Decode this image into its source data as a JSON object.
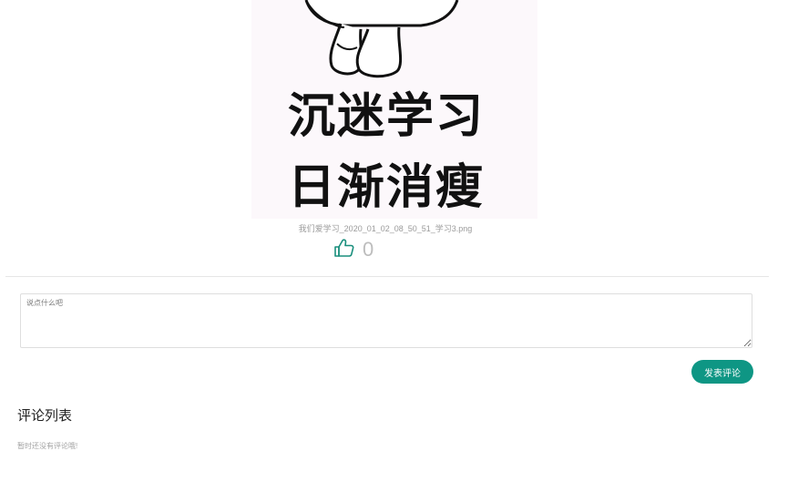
{
  "post": {
    "image_text_line1": "沉迷学习",
    "image_text_line2": "日渐消瘦",
    "image_caption": "我们爱学习_2020_01_02_08_50_51_学习3.png",
    "like_count": "0"
  },
  "comment": {
    "placeholder": "说点什么吧",
    "submit_label": "发表评论"
  },
  "comment_list": {
    "title": "评论列表",
    "empty_text": "暂时还没有评论哦!"
  },
  "colors": {
    "accent": "#0e9684",
    "like_icon": "#1a8f7d"
  },
  "icons": {
    "like": "thumbs-up-icon"
  }
}
